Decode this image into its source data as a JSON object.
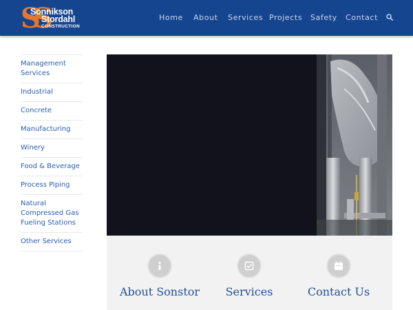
{
  "brand": {
    "line1": "Sonnikson",
    "line2": "Stordahl",
    "line3": "CONSTRUCTION",
    "initials": "SS",
    "colors": {
      "header": "#15458f",
      "accent": "#e4782a",
      "link": "#2a5db0"
    }
  },
  "nav": {
    "items": [
      "Home",
      "About",
      "Services",
      "Projects",
      "Safety",
      "Contact"
    ],
    "search_icon": "search-icon"
  },
  "sidebar": {
    "items": [
      {
        "label": "Management Services"
      },
      {
        "label": "Industrial"
      },
      {
        "label": "Concrete"
      },
      {
        "label": "Manufacturing"
      },
      {
        "label": "Winery"
      },
      {
        "label": "Food & Beverage"
      },
      {
        "label": "Process Piping"
      },
      {
        "label": "Natural Compressed Gas Fueling Stations"
      },
      {
        "label": "Other Services"
      }
    ]
  },
  "features": [
    {
      "title": "About Sonstor",
      "icon": "info-icon"
    },
    {
      "title": "Services",
      "icon": "checkbox-icon"
    },
    {
      "title": "Contact Us",
      "icon": "calendar-icon"
    }
  ]
}
